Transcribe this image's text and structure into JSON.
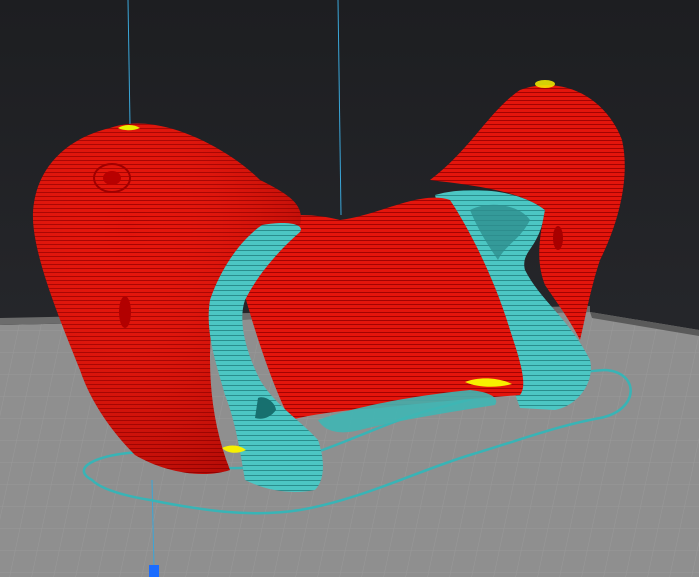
{
  "viewport": {
    "background_color": "#1f2023",
    "view": "3d-layer-preview"
  },
  "colors": {
    "bed_top": "#8d8d8d",
    "bed_edge": "#4b4b4b",
    "grid_line": "#a7a7a7",
    "model_wall": "#e8140c",
    "model_dark": "#a80000",
    "support": "#46c2c0",
    "support_dark": "#17706f",
    "skirt": "#38b4b6",
    "highlight_yellow": "#f7f000",
    "axis_line": "#3aa6d8",
    "origin_marker": "#1a6cff"
  },
  "icons": {
    "origin_marker": "origin-marker-icon"
  }
}
